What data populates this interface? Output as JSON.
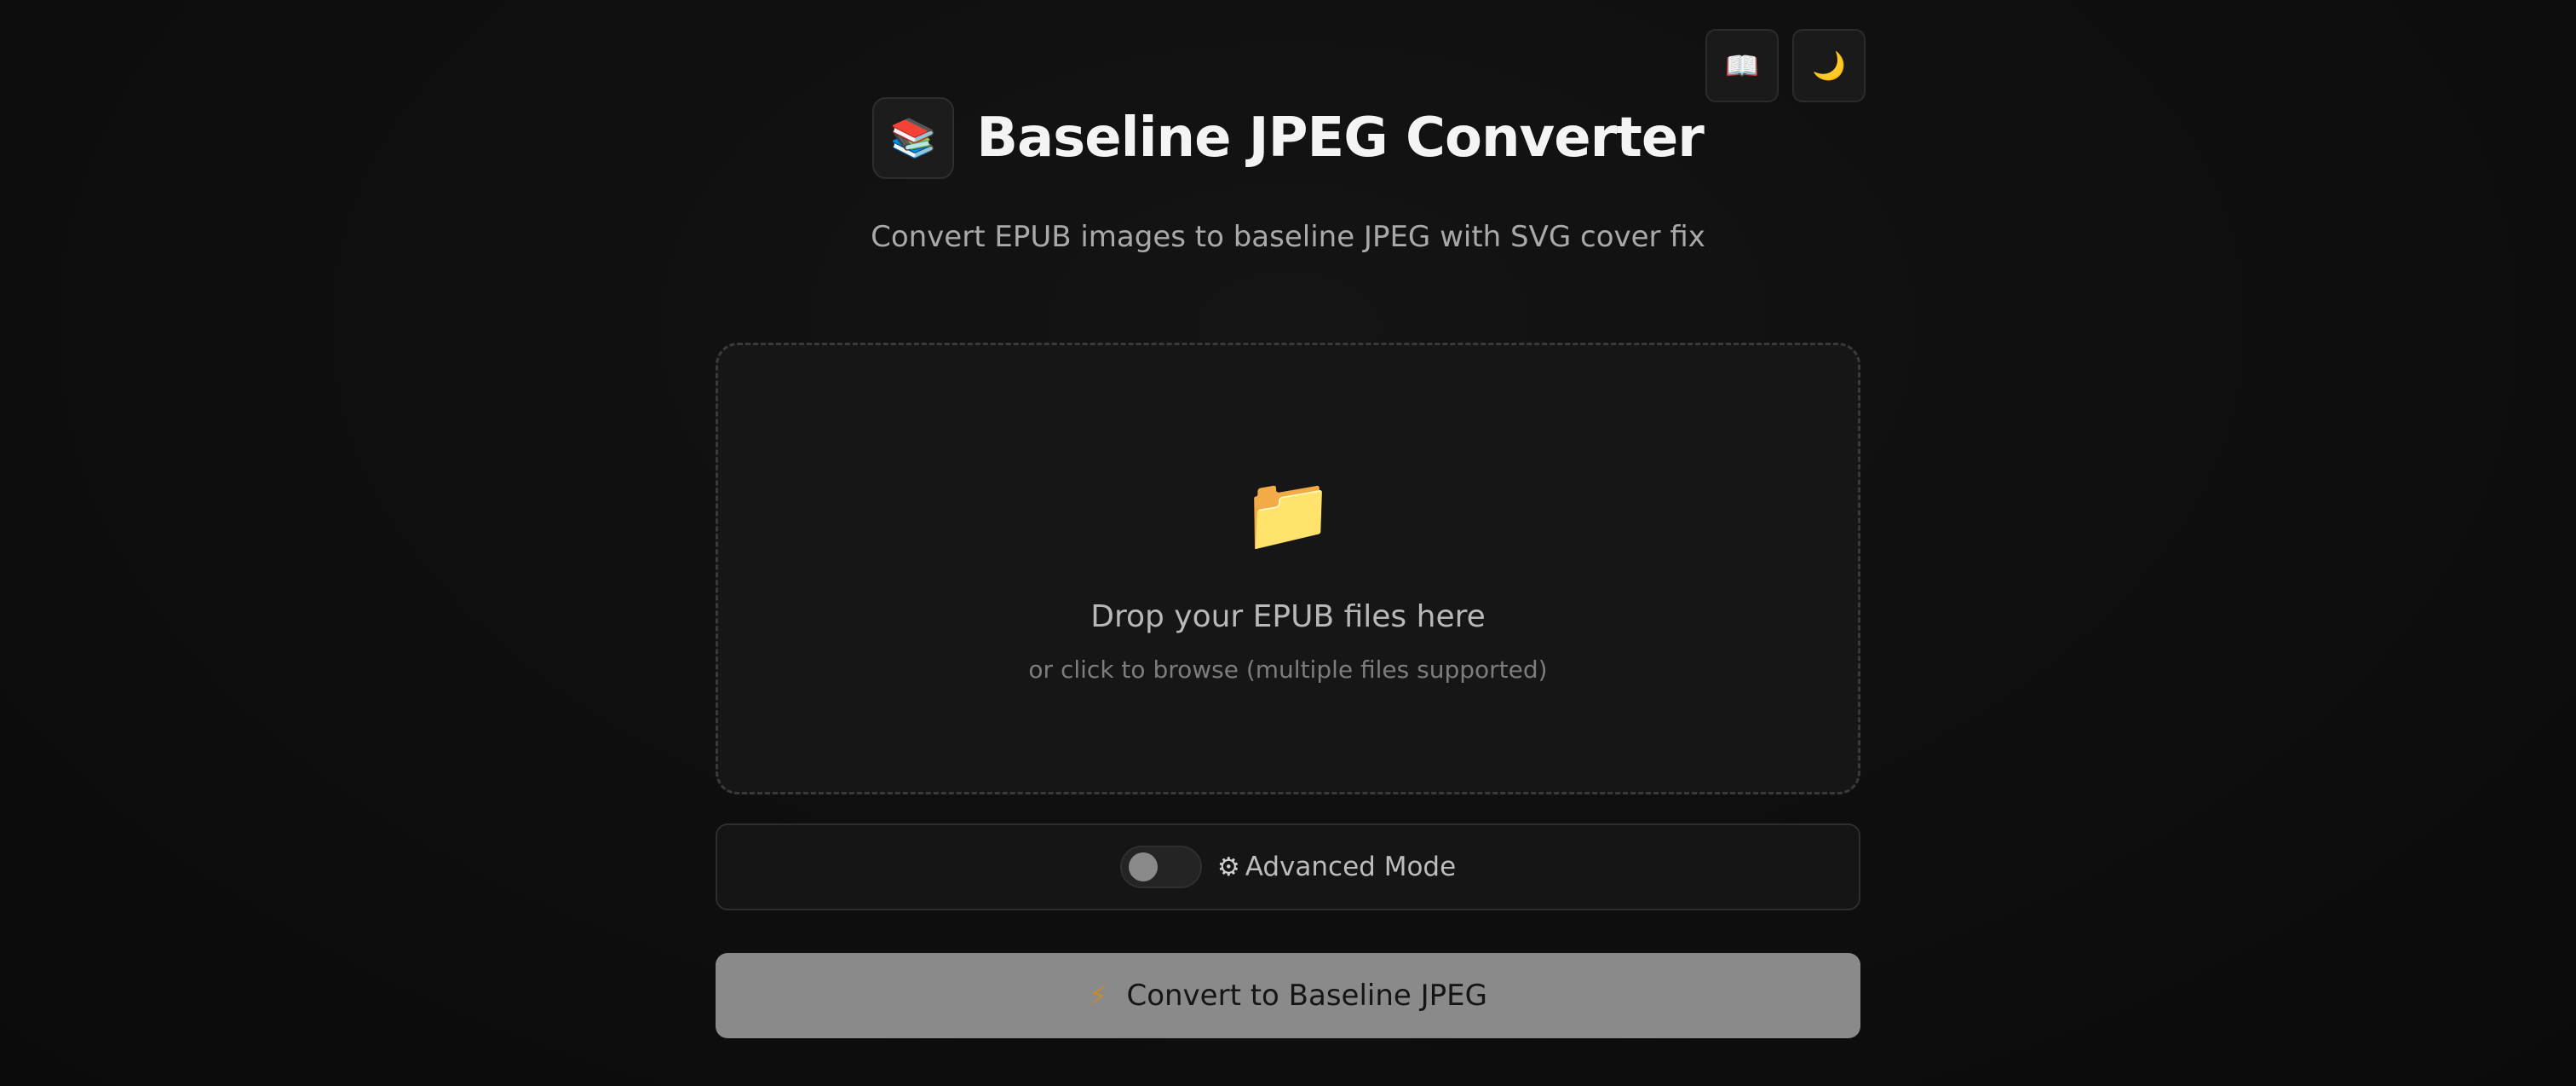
{
  "top_icons": {
    "book_glyph": "📖",
    "moon_glyph": "🌙"
  },
  "header": {
    "logo_glyph": "📚",
    "title": "Baseline JPEG Converter",
    "subtitle": "Convert EPUB images to baseline JPEG with SVG cover fix"
  },
  "dropzone": {
    "folder_glyph": "📁",
    "title": "Drop your EPUB files here",
    "subtitle": "or click to browse (multiple files supported)"
  },
  "advanced": {
    "gear_glyph": "⚙",
    "label": "Advanced Mode",
    "enabled": false
  },
  "convert": {
    "bolt_glyph": "⚡",
    "label": "Convert to Baseline JPEG"
  },
  "colors": {
    "background": "#0e0e0e",
    "button_fill": "#8a8a8a",
    "bolt": "#c98b2a"
  }
}
